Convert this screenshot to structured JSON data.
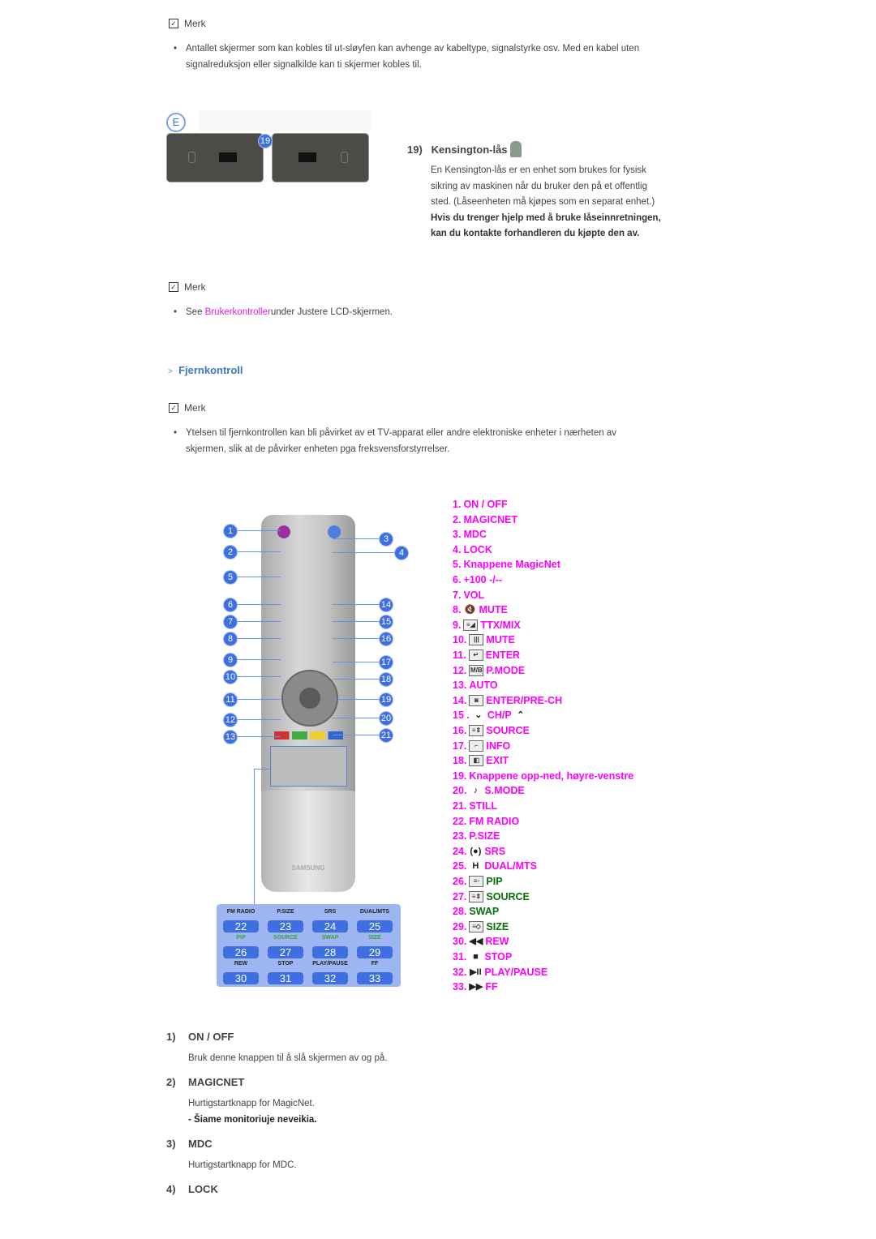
{
  "note1": {
    "label": "Merk",
    "bullet": "Antallet skjermer som kan kobles til ut-sløyfen kan avhenge av kabeltype, signalstyrke osv. Med en kabel uten signalreduksjon eller signalkilde kan ti skjermer kobles til."
  },
  "figure_e": {
    "badge": "E",
    "callout": "19"
  },
  "kensington": {
    "number": "19)",
    "title": "Kensington-lås",
    "icon": "padlock-icon",
    "body": "En Kensington-lås er en enhet som brukes for fysisk sikring av maskinen når du bruker den på et offentlig sted. (Låseenheten må kjøpes som en separat enhet.)",
    "bold": "Hvis du trenger hjelp med å bruke låseinnretningen, kan du kontakte forhandleren du kjøpte den av."
  },
  "note2": {
    "label": "Merk",
    "prefix": "See ",
    "link": "Brukerkontroller",
    "suffix": "under Justere LCD-skjermen."
  },
  "section": {
    "marker": ">",
    "title": "Fjernkontroll"
  },
  "note3": {
    "label": "Merk",
    "bullet": "Ytelsen til fjernkontrollen kan bli påvirket av et TV-apparat eller andre elektroniske enheter i nærheten av skjermen, slik at de påvirker enheten pga freksvensforstyrrelser."
  },
  "colors": {
    "accent": "#ff00ff",
    "heading": "#3a78c8",
    "green": "#0a6e0a",
    "callout": "#3d6fe0"
  },
  "remote": {
    "callouts_left": [
      "1",
      "2",
      "5",
      "6",
      "7",
      "8",
      "9",
      "10",
      "11",
      "12",
      "13"
    ],
    "callouts_right": [
      "3",
      "4",
      "14",
      "15",
      "16",
      "17",
      "18",
      "19",
      "20",
      "21"
    ],
    "brand": "SAMSUNG",
    "panel_labels": [
      "FM RADIO",
      "P.SIZE",
      "SRS",
      "DUAL/MTS",
      "PIP",
      "SOURCE",
      "SWAP",
      "SIZE",
      "REW",
      "STOP",
      "PLAY/PAUSE",
      "FF"
    ],
    "panel_numbers": [
      "22",
      "23",
      "24",
      "25",
      "26",
      "27",
      "28",
      "29",
      "30",
      "31",
      "32",
      "33"
    ]
  },
  "button_list": [
    {
      "num": "1.",
      "label": "ON / OFF"
    },
    {
      "num": "2.",
      "label": "MAGICNET"
    },
    {
      "num": "3.",
      "label": "MDC"
    },
    {
      "num": "4.",
      "label": "LOCK"
    },
    {
      "num": "5.",
      "label": "Knappene MagicNet"
    },
    {
      "num": "6.",
      "label": "+100 -/--"
    },
    {
      "num": "7.",
      "label": "VOL"
    },
    {
      "num": "8.",
      "icon": "mute-speaker-icon",
      "label": "MUTE"
    },
    {
      "num": "9.",
      "icon": "teletext-mix-icon",
      "label": "TTX/MIX"
    },
    {
      "num": "10.",
      "icon": "columns-icon",
      "label": "MUTE"
    },
    {
      "num": "11.",
      "icon": "enter-icon",
      "label": "ENTER"
    },
    {
      "num": "12.",
      "icon": "mb-icon",
      "icon_text": "M/B",
      "label": "P.MODE"
    },
    {
      "num": "13.",
      "label": "AUTO"
    },
    {
      "num": "14.",
      "icon": "pre-ch-icon",
      "label": "ENTER/PRE-CH"
    },
    {
      "num": "15 .",
      "icon": "chevron-down-icon",
      "label": "CH/P",
      "icon_after": "chevron-up-icon"
    },
    {
      "num": "16.",
      "icon": "source-icon",
      "label": "SOURCE"
    },
    {
      "num": "17.",
      "icon": "info-icon",
      "label": "INFO"
    },
    {
      "num": "18.",
      "icon": "exit-icon",
      "label": "EXIT"
    },
    {
      "num": "19.",
      "label": "Knappene opp-ned, høyre-venstre"
    },
    {
      "num": "20.",
      "icon": "s-mode-icon",
      "label": "S.MODE"
    },
    {
      "num": "21.",
      "label": "STILL"
    },
    {
      "num": "22.",
      "label": "FM RADIO"
    },
    {
      "num": "23.",
      "label": "P.SIZE"
    },
    {
      "num": "24.",
      "icon": "srs-icon",
      "label": "SRS"
    },
    {
      "num": "25.",
      "icon": "dual-icon",
      "label": "DUAL/MTS"
    },
    {
      "num": "26.",
      "icon": "pip-icon",
      "label": "PIP",
      "green": true
    },
    {
      "num": "27.",
      "icon": "source-icon",
      "label": "SOURCE",
      "green": true
    },
    {
      "num": "28.",
      "label": "SWAP",
      "green": true
    },
    {
      "num": "29.",
      "icon": "size-icon",
      "label": "SIZE",
      "green": true
    },
    {
      "num": "30.",
      "icon": "rewind-icon",
      "label": "REW"
    },
    {
      "num": "31.",
      "icon": "stop-icon",
      "label": "STOP"
    },
    {
      "num": "32.",
      "icon": "play-pause-icon",
      "label": "PLAY/PAUSE"
    },
    {
      "num": "33.",
      "icon": "fast-forward-icon",
      "label": "FF"
    }
  ],
  "details": [
    {
      "num": "1)",
      "title": "ON / OFF",
      "body": "Bruk denne knappen til å slå skjermen av og på."
    },
    {
      "num": "2)",
      "title": "MAGICNET",
      "body": "Hurtigstartknapp for MagicNet.",
      "bold": "- Šiame monitoriuje neveikia."
    },
    {
      "num": "3)",
      "title": "MDC",
      "body": "Hurtigstartknapp for MDC."
    },
    {
      "num": "4)",
      "title": "LOCK"
    }
  ]
}
